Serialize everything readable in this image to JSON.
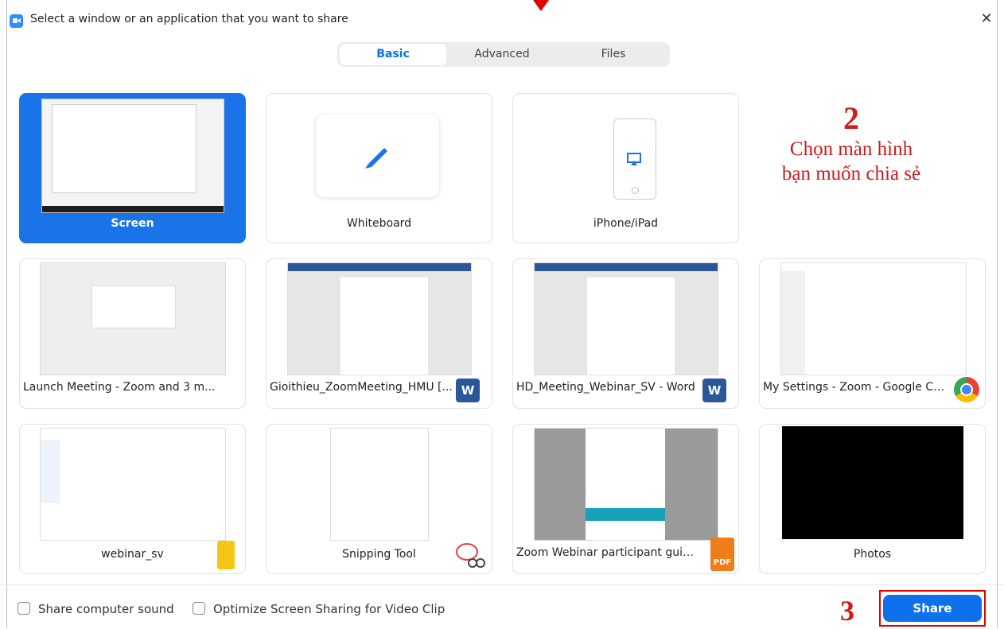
{
  "window": {
    "title": "Select a window or an application that you want to share"
  },
  "tabs": [
    {
      "label": "Basic",
      "active": true
    },
    {
      "label": "Advanced",
      "active": false
    },
    {
      "label": "Files",
      "active": false
    }
  ],
  "cards": {
    "screen": "Screen",
    "whiteboard": "Whiteboard",
    "iphone": "iPhone/iPad",
    "launch": "Launch Meeting - Zoom and 3 m...",
    "gioithieu": "Gioithieu_ZoomMeeting_HMU [...",
    "hd_meeting": "HD_Meeting_Webinar_SV - Word",
    "my_settings": "My Settings - Zoom - Google Chr...",
    "webinar_sv": "webinar_sv",
    "snipping": "Snipping Tool",
    "zoom_webinar": "Zoom Webinar participant guide....",
    "photos": "Photos"
  },
  "badges": {
    "word": "W",
    "pdf": "PDF"
  },
  "annotations": {
    "step2_number": "2",
    "step2_line1": "Chọn màn hình",
    "step2_line2": "bạn muốn chia sẻ",
    "step3_number": "3"
  },
  "options": {
    "share_sound": "Share computer sound",
    "optimize": "Optimize Screen Sharing for Video Clip"
  },
  "share_button": "Share",
  "colors": {
    "accent": "#0e71eb",
    "selected": "#1a73e8",
    "annotation": "#d11a1a"
  }
}
